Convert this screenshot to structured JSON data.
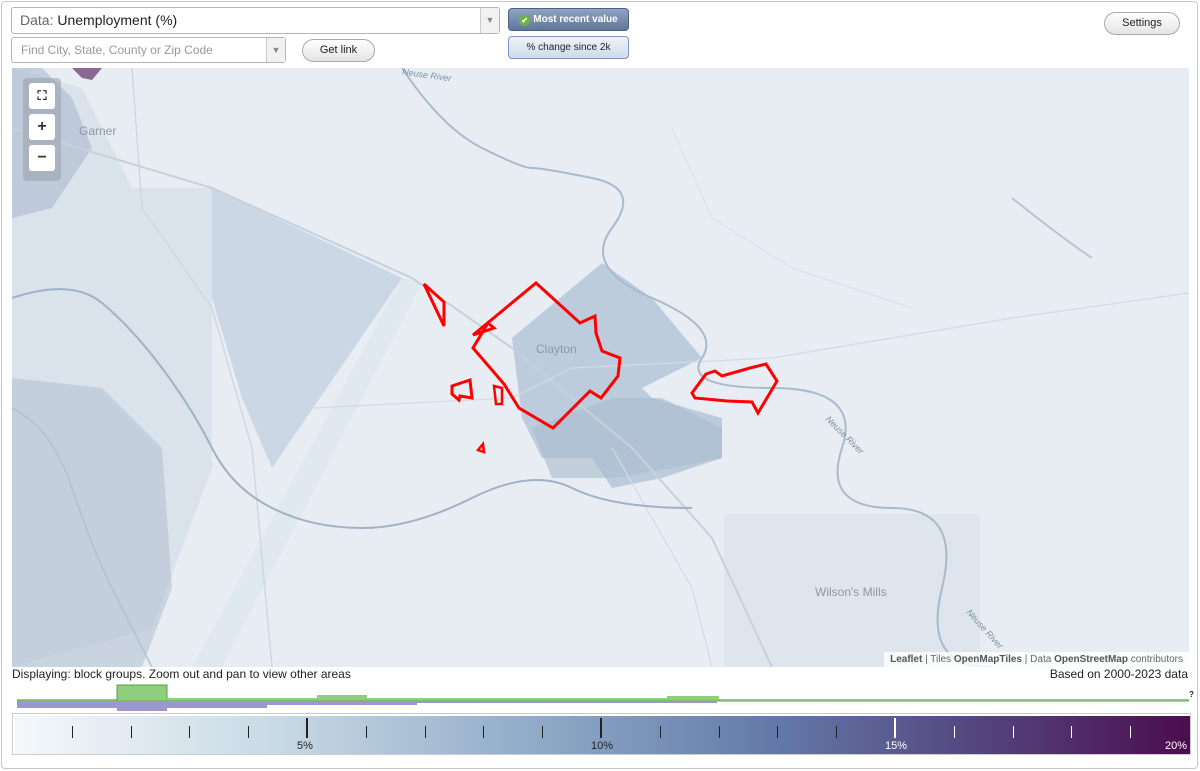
{
  "data_select": {
    "label": "Data:",
    "value": "Unemployment (%)"
  },
  "search": {
    "placeholder": "Find City, State, County or Zip Code"
  },
  "buttons": {
    "get_link": "Get link",
    "settings": "Settings",
    "most_recent": "Most recent value",
    "pct_change": "% change since 2k"
  },
  "map": {
    "places": {
      "garner": "Garner",
      "clayton": "Clayton",
      "wilsons_mills": "Wilson's Mills"
    },
    "rivers": {
      "neuse_top": "Neuse River",
      "neuse_right": "Neuse River",
      "neuse_bottom": "Neuse River"
    },
    "attribution": {
      "leaflet": "Leaflet",
      "sep1": " | Tiles ",
      "tiles": "OpenMapTiles",
      "sep2": " | Data ",
      "data": "OpenStreetMap",
      "contributors": " contributors"
    }
  },
  "footer": {
    "displaying": "Displaying: block groups. Zoom out and pan to view other areas",
    "based_on": "Based on 2000-2023 data",
    "unknown_mark": "?"
  },
  "legend": {
    "labels": [
      "5%",
      "10%",
      "15%",
      "20%"
    ],
    "min": 0,
    "max": 20
  },
  "colors": {
    "highlight": "#ff0000",
    "map_base": "#e7edf3",
    "hist_green": "#8fce7c",
    "hist_purple": "#9a98cc"
  }
}
